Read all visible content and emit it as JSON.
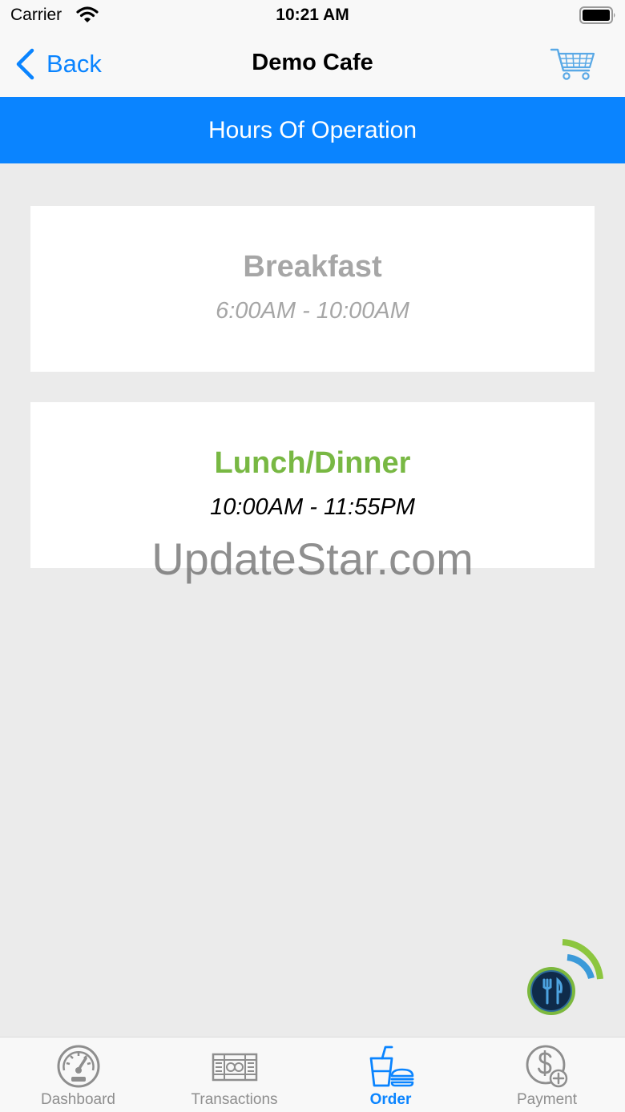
{
  "status_bar": {
    "carrier": "Carrier",
    "time": "10:21 AM"
  },
  "nav": {
    "back_label": "Back",
    "title": "Demo Cafe",
    "cart_icon": "shopping-cart-icon"
  },
  "banner": {
    "title": "Hours Of Operation"
  },
  "meal_periods": [
    {
      "name": "Breakfast",
      "hours": "6:00AM - 10:00AM",
      "state": "inactive"
    },
    {
      "name": "Lunch/Dinner",
      "hours": "10:00AM - 11:55PM",
      "state": "active"
    }
  ],
  "watermark": "UpdateStar.com",
  "tabs": [
    {
      "label": "Dashboard",
      "icon": "speedometer-icon",
      "active": false
    },
    {
      "label": "Transactions",
      "icon": "receipts-icon",
      "active": false
    },
    {
      "label": "Order",
      "icon": "drink-food-icon",
      "active": true
    },
    {
      "label": "Payment",
      "icon": "dollar-add-icon",
      "active": false
    }
  ],
  "colors": {
    "accent": "#0a84ff",
    "background": "#ebebeb",
    "active_period": "#78b843",
    "inactive_period": "#a6a6a6",
    "fab_ring": "#7cb83e",
    "fab_fill": "#0f2b4a"
  }
}
